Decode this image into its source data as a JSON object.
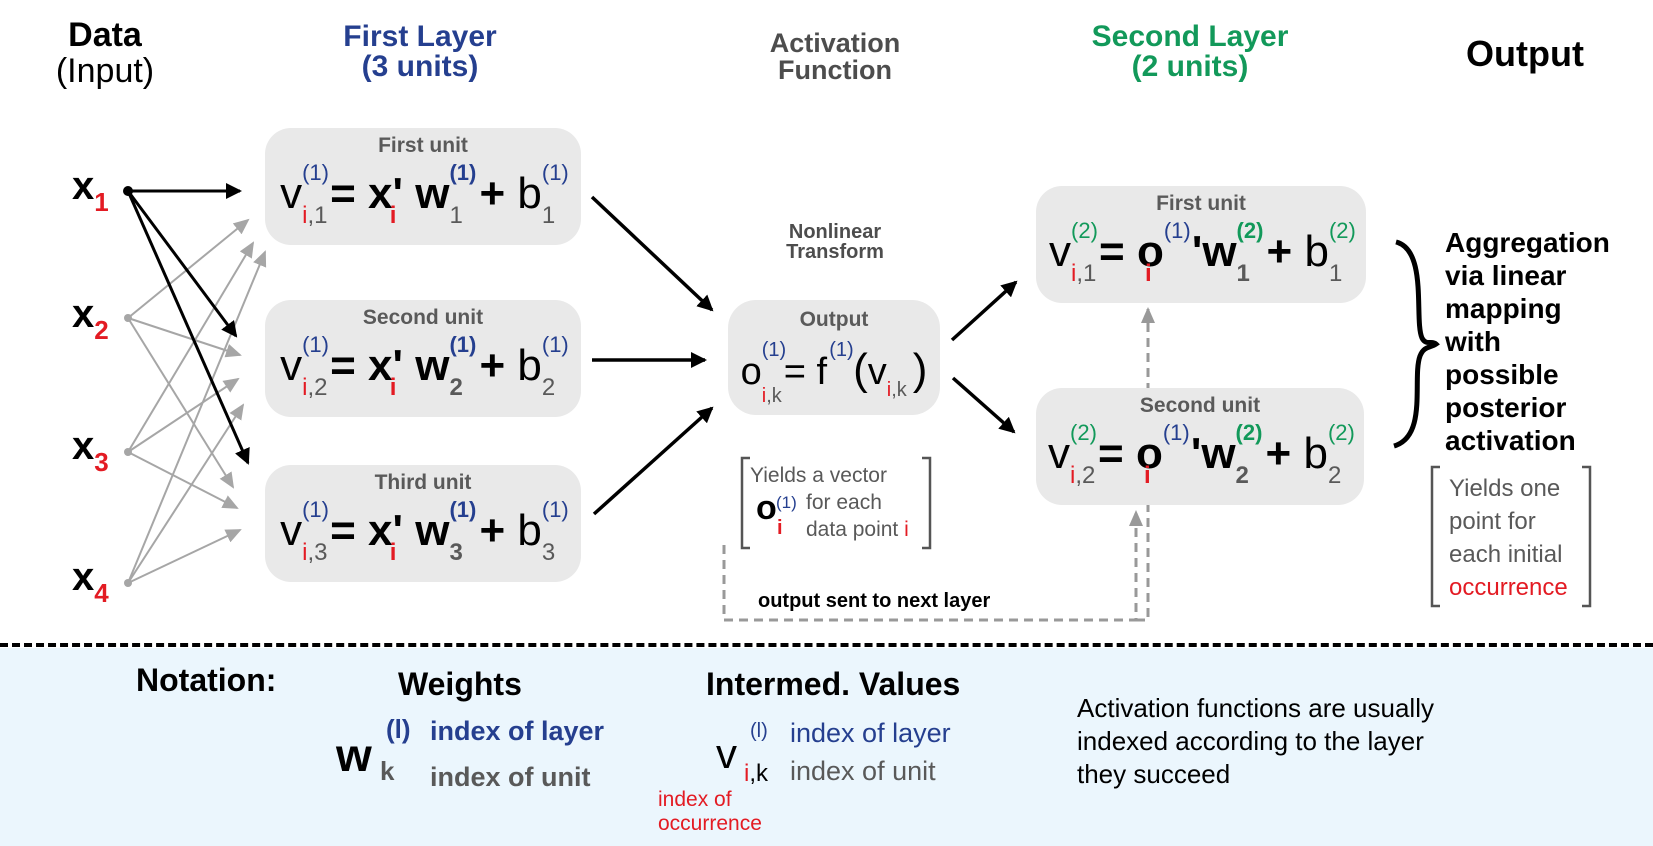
{
  "headers": {
    "data_line1": "Data",
    "data_line2": "(Input)",
    "first_layer_line1": "First Layer",
    "first_layer_line2": "(3 units)",
    "activation_line1": "Activation",
    "activation_line2": "Function",
    "second_layer_line1": "Second Layer",
    "second_layer_line2": "(2 units)",
    "output": "Output"
  },
  "inputs": [
    {
      "symbol": "x",
      "index": "1"
    },
    {
      "symbol": "x",
      "index": "2"
    },
    {
      "symbol": "x",
      "index": "3"
    },
    {
      "symbol": "x",
      "index": "4"
    }
  ],
  "first_layer": {
    "units": [
      {
        "title": "First unit",
        "lhs": "v",
        "lhs_sup": "(1)",
        "lhs_sub_i": "i",
        "lhs_sub_k": ",1",
        "x": "x'",
        "x_sub": "i",
        "w": "w",
        "w_sup": "(1)",
        "w_sub": "1",
        "plus": "+",
        "b": "b",
        "b_sup": "(1)",
        "b_sub": "1",
        "eq": "="
      },
      {
        "title": "Second unit",
        "lhs": "v",
        "lhs_sup": "(1)",
        "lhs_sub_i": "i",
        "lhs_sub_k": ",2",
        "x": "x'",
        "x_sub": "i",
        "w": "w",
        "w_sup": "(1)",
        "w_sub": "2",
        "plus": "+",
        "b": "b",
        "b_sup": "(1)",
        "b_sub": "2",
        "eq": "="
      },
      {
        "title": "Third unit",
        "lhs": "v",
        "lhs_sup": "(1)",
        "lhs_sub_i": "i",
        "lhs_sub_k": ",3",
        "x": "x'",
        "x_sub": "i",
        "w": "w",
        "w_sup": "(1)",
        "w_sub": "3",
        "plus": "+",
        "b": "b",
        "b_sup": "(1)",
        "b_sub": "3",
        "eq": "="
      }
    ]
  },
  "activation": {
    "label_line1": "Nonlinear",
    "label_line2": "Transform",
    "box_title": "Output",
    "o": "o",
    "o_sup": "(1)",
    "o_sub_i": "i",
    "o_sub_k": ",k",
    "eq": "=",
    "f": "f",
    "f_sup": "(1)",
    "lparen": "(",
    "v": "v",
    "v_sub_i": "i",
    "v_sub_k": ",k",
    "rparen": ")",
    "note_line1": "Yields a vector",
    "note_o": "o",
    "note_o_sup": "(1)",
    "note_o_sub": "i",
    "note_line2": "for each",
    "note_line3": "data point",
    "note_line3_i": "i",
    "feedback_label": "output sent to next layer"
  },
  "second_layer": {
    "units": [
      {
        "title": "First unit",
        "lhs": "v",
        "lhs_sup": "(2)",
        "lhs_sub_i": "i",
        "lhs_sub_k": ",1",
        "o": "o",
        "o_sup": "(1)",
        "o_sub": "i",
        "prime": "'",
        "w": "w",
        "w_sup": "(2)",
        "w_sub": "1",
        "plus": "+",
        "b": "b",
        "b_sup": "(2)",
        "b_sub": "1",
        "eq": "="
      },
      {
        "title": "Second unit",
        "lhs": "v",
        "lhs_sup": "(2)",
        "lhs_sub_i": "i",
        "lhs_sub_k": ",2",
        "o": "o",
        "o_sup": "(1)",
        "o_sub": "i",
        "prime": "'",
        "w": "w",
        "w_sup": "(2)",
        "w_sub": "2",
        "plus": "+",
        "b": "b",
        "b_sup": "(2)",
        "b_sub": "2",
        "eq": "="
      }
    ]
  },
  "output": {
    "aggregation_lines": [
      "Aggregation",
      "via linear",
      "mapping",
      "with",
      "possible",
      "posterior",
      "activation"
    ],
    "note_lines": [
      "Yields one",
      "point for",
      "each initial"
    ],
    "note_red": "occurrence"
  },
  "notation": {
    "title": "Notation:",
    "weights_title": "Weights",
    "weights_symbol": "w",
    "weights_sup": "(l)",
    "weights_sub": "k",
    "weights_layer_text": "index of layer",
    "weights_unit_text": "index of unit",
    "intermed_title": "Intermed. Values",
    "intermed_symbol": "v",
    "intermed_sup": "(l)",
    "intermed_sub_i": "i",
    "intermed_sub_k": ",k",
    "intermed_layer_text": "index of layer",
    "intermed_unit_text": "index of unit",
    "occurrence_line1": "index of",
    "occurrence_line2": "occurrence",
    "activation_note": [
      "Activation functions are usually",
      "indexed according to the layer",
      "they succeed"
    ]
  },
  "colors": {
    "layer1_blue": "#253f8f",
    "layer2_green": "#12995a",
    "index_red": "#e31b23",
    "box_gray": "#e9e9e9",
    "notation_bg": "#ebf6fd"
  }
}
